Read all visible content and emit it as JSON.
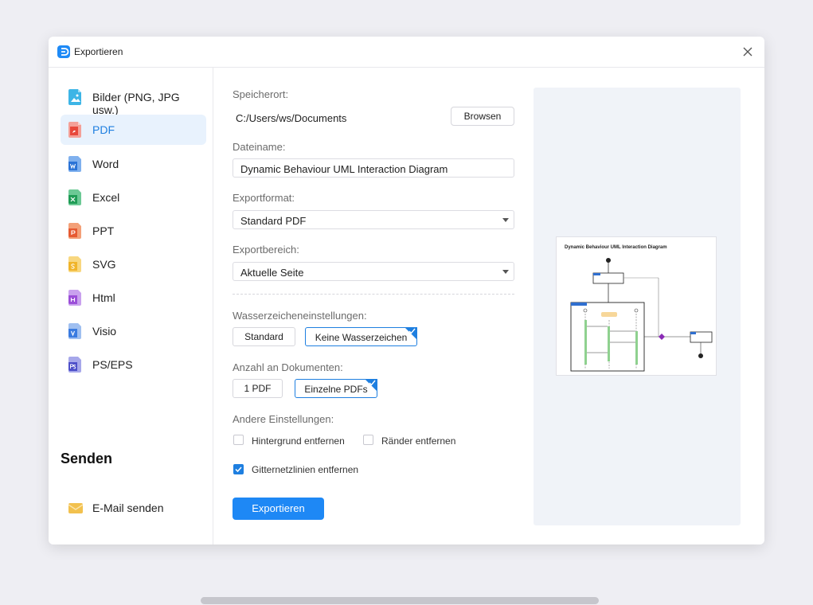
{
  "window": {
    "title": "Exportieren"
  },
  "sidebar": {
    "items": [
      {
        "label": "Bilder (PNG, JPG usw.)",
        "icon": "image-icon",
        "color": "#3db5e6"
      },
      {
        "label": "PDF",
        "icon": "pdf-icon",
        "color": "#e8483b"
      },
      {
        "label": "Word",
        "icon": "word-icon",
        "color": "#2b73d6"
      },
      {
        "label": "Excel",
        "icon": "excel-icon",
        "color": "#1f9c55"
      },
      {
        "label": "PPT",
        "icon": "ppt-icon",
        "color": "#e65a32"
      },
      {
        "label": "SVG",
        "icon": "svg-icon",
        "color": "#f0b42a"
      },
      {
        "label": "Html",
        "icon": "html-icon",
        "color": "#9b4fd8"
      },
      {
        "label": "Visio",
        "icon": "visio-icon",
        "color": "#3a7be0"
      },
      {
        "label": "PS/EPS",
        "icon": "ps-icon",
        "color": "#4d4fc9"
      }
    ],
    "active_index": 1,
    "send_title": "Senden",
    "send_items": [
      {
        "label": "E-Mail senden",
        "icon": "mail-icon",
        "color": "#f2c14e"
      }
    ]
  },
  "form": {
    "location_label": "Speicherort:",
    "location_value": "C:/Users/ws/Documents",
    "browse_label": "Browsen",
    "filename_label": "Dateiname:",
    "filename_value": "Dynamic Behaviour UML Interaction Diagram",
    "format_label": "Exportformat:",
    "format_value": "Standard PDF",
    "range_label": "Exportbereich:",
    "range_value": "Aktuelle Seite",
    "watermark_label": "Wasserzeicheneinstellungen:",
    "watermark_options": [
      "Standard",
      "Keine Wasserzeichen"
    ],
    "watermark_selected": 1,
    "doc_count_label": "Anzahl an Dokumenten:",
    "doc_count_options": [
      "1 PDF",
      "Einzelne PDFs"
    ],
    "doc_count_selected": 1,
    "other_label": "Andere Einstellungen:",
    "checkboxes": [
      {
        "label": "Hintergrund entfernen",
        "checked": false
      },
      {
        "label": "Ränder entfernen",
        "checked": false
      },
      {
        "label": "Gitternetzlinien entfernen",
        "checked": true
      }
    ],
    "export_label": "Exportieren"
  },
  "preview": {
    "title": "Dynamic Behaviour UML Interaction Diagram"
  },
  "colors": {
    "accent": "#1e88f5",
    "selected_bg": "#e8f2fd",
    "preview_bg": "#f0f3f8"
  }
}
